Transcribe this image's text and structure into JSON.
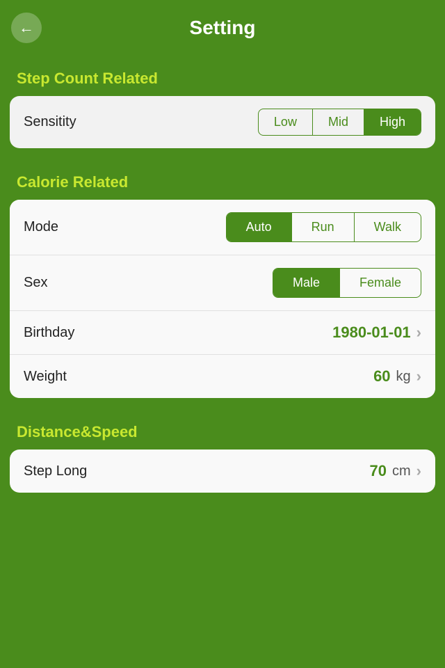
{
  "header": {
    "title": "Setting",
    "back_label": "‹"
  },
  "sections": {
    "step_count": {
      "label": "Step Count Related",
      "sensitivity": {
        "row_label": "Sensitity",
        "options": [
          "Low",
          "Mid",
          "High"
        ],
        "active": "High"
      }
    },
    "calorie": {
      "label": "Calorie Related",
      "mode": {
        "row_label": "Mode",
        "options": [
          "Auto",
          "Run",
          "Walk"
        ],
        "active": "Auto"
      },
      "sex": {
        "row_label": "Sex",
        "options": [
          "Male",
          "Female"
        ],
        "active": "Male"
      },
      "birthday": {
        "row_label": "Birthday",
        "value": "1980-01-01",
        "unit": "",
        "has_chevron": true
      },
      "weight": {
        "row_label": "Weight",
        "value": "60",
        "unit": "kg",
        "has_chevron": true
      }
    },
    "distance_speed": {
      "label": "Distance&Speed",
      "step_long": {
        "row_label": "Step Long",
        "value": "70",
        "unit": "cm",
        "has_chevron": true
      }
    }
  }
}
